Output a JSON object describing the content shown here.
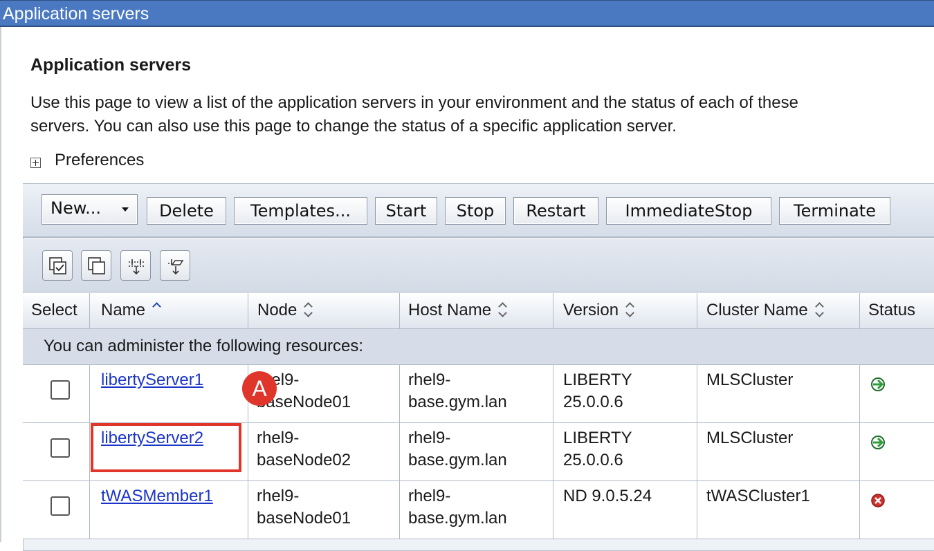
{
  "window": {
    "title": "Application servers"
  },
  "page": {
    "heading": "Application servers",
    "description_line1": "Use this page to view a list of the application servers in your environment and the status of each of these",
    "description_line2": "servers. You can also use this page to change the status of a specific application server.",
    "preferences_label": "Preferences"
  },
  "toolbar": {
    "new": "New...",
    "delete": "Delete",
    "templates": "Templates...",
    "start": "Start",
    "stop": "Stop",
    "restart": "Restart",
    "immediate_stop": "ImmediateStop",
    "terminate": "Terminate"
  },
  "table_tools": [
    "select-all-icon",
    "deselect-all-icon",
    "show-filter-icon",
    "clear-filter-icon"
  ],
  "table": {
    "headers": {
      "select": "Select",
      "name": "Name",
      "node": "Node",
      "host": "Host Name",
      "version": "Version",
      "cluster": "Cluster Name",
      "status": "Status"
    },
    "info": "You can administer the following resources:",
    "rows": [
      {
        "name": "libertyServer1",
        "node_l1": "rhel9-",
        "node_l2": "baseNode01",
        "host_l1": "rhel9-",
        "host_l2": "base.gym.lan",
        "version_l1": "LIBERTY",
        "version_l2": "25.0.0.6",
        "cluster": "MLSCluster",
        "status": "started"
      },
      {
        "name": "libertyServer2",
        "node_l1": "rhel9-",
        "node_l2": "baseNode02",
        "host_l1": "rhel9-",
        "host_l2": "base.gym.lan",
        "version_l1": "LIBERTY",
        "version_l2": "25.0.0.6",
        "cluster": "MLSCluster",
        "status": "started"
      },
      {
        "name": "tWASMember1",
        "node_l1": "rhel9-",
        "node_l2": "baseNode01",
        "host_l1": "rhel9-",
        "host_l2": "base.gym.lan",
        "version_l1": "ND 9.0.5.24",
        "version_l2": "",
        "cluster": "tWASCluster1",
        "status": "stopped"
      }
    ]
  },
  "annotation": {
    "badge": "A"
  },
  "colors": {
    "title_bar": "#4a79c2",
    "link": "#1a35c8",
    "highlight": "#e0352b",
    "started": "#2e9e3a",
    "stopped": "#d0312d"
  }
}
